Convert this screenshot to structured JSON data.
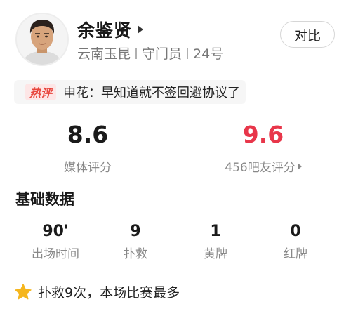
{
  "player": {
    "name": "余鉴贤",
    "team": "云南玉昆",
    "position": "守门员",
    "number": "24号"
  },
  "compare_button": "对比",
  "hot_comment": {
    "badge": "热评",
    "text": "申花：早知道就不签回避协议了"
  },
  "ratings": {
    "media": {
      "value": "8.6",
      "label": "媒体评分"
    },
    "fans": {
      "value": "9.6",
      "label": "456吧友评分"
    }
  },
  "stats": {
    "title": "基础数据",
    "items": [
      {
        "value": "90'",
        "label": "出场时间"
      },
      {
        "value": "9",
        "label": "扑救"
      },
      {
        "value": "1",
        "label": "黄牌"
      },
      {
        "value": "0",
        "label": "红牌"
      }
    ]
  },
  "highlight": {
    "icon": "star-icon",
    "text": "扑救9次，本场比赛最多"
  },
  "colors": {
    "fan_rating": "#e8364a",
    "hot_badge": "#e8453c",
    "star": "#f5b61e"
  }
}
